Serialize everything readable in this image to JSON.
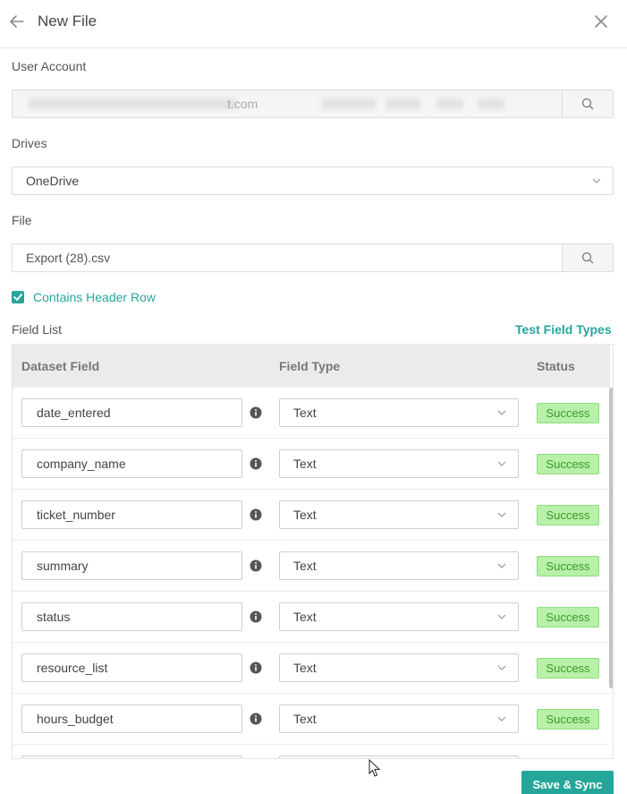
{
  "header": {
    "title": "New File"
  },
  "user_account": {
    "label": "User Account",
    "value": "t.com"
  },
  "drives": {
    "label": "Drives",
    "value": "OneDrive"
  },
  "file": {
    "label": "File",
    "value": "Export (28).csv"
  },
  "header_row": {
    "label": "Contains Header Row",
    "checked": true
  },
  "field_list": {
    "label": "Field List",
    "test_link": "Test Field Types",
    "columns": [
      "Dataset Field",
      "Field Type",
      "Status"
    ],
    "rows": [
      {
        "field": "date_entered",
        "type": "Text",
        "status": "Success"
      },
      {
        "field": "company_name",
        "type": "Text",
        "status": "Success"
      },
      {
        "field": "ticket_number",
        "type": "Text",
        "status": "Success"
      },
      {
        "field": "summary",
        "type": "Text",
        "status": "Success"
      },
      {
        "field": "status",
        "type": "Text",
        "status": "Success"
      },
      {
        "field": "resource_list",
        "type": "Text",
        "status": "Success"
      },
      {
        "field": "hours_budget",
        "type": "Text",
        "status": "Success"
      }
    ]
  },
  "footer": {
    "save_label": "Save & Sync"
  },
  "colors": {
    "accent": "#26a69a",
    "success_bg": "#b7f0a8",
    "success_text": "#3c9a2a"
  }
}
